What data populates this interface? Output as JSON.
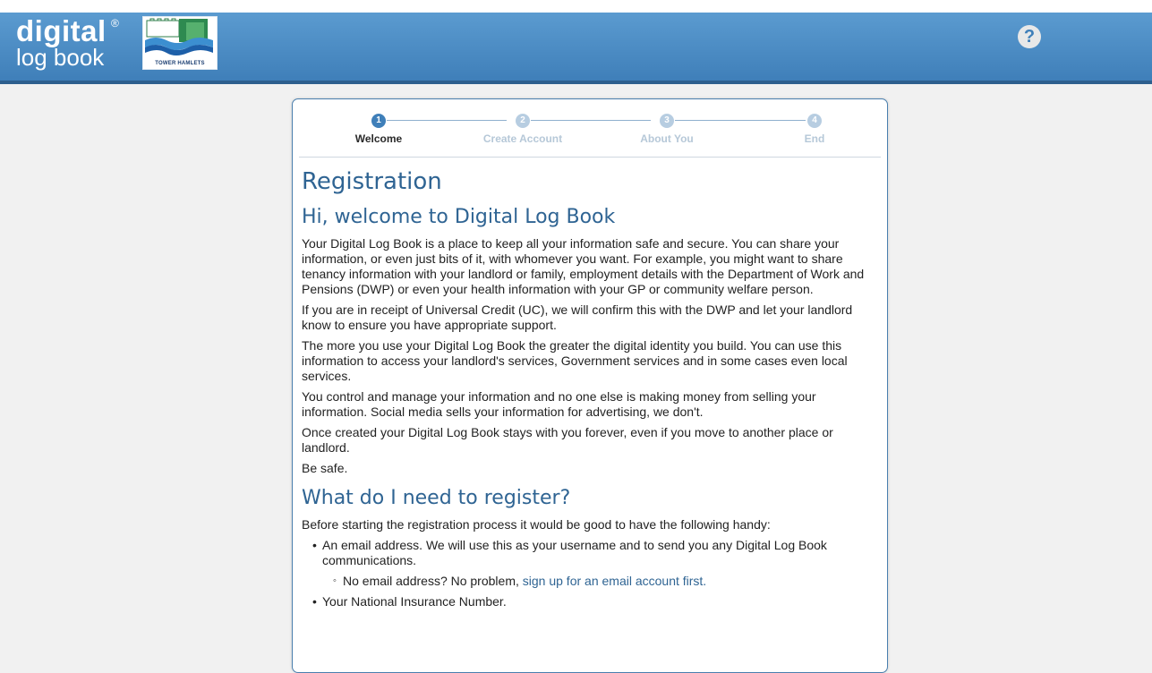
{
  "header": {
    "brand_line1": "digital",
    "brand_reg": "®",
    "brand_line2": "log book",
    "council_caption": "TOWER HAMLETS",
    "help_icon": "question-circle-icon",
    "colors": {
      "header_blue": "#4a8cc7",
      "accent": "#2f6493"
    }
  },
  "stepper": {
    "steps": [
      {
        "number": "1",
        "label": "Welcome"
      },
      {
        "number": "2",
        "label": "Create Account"
      },
      {
        "number": "3",
        "label": "About You"
      },
      {
        "number": "4",
        "label": "End"
      }
    ]
  },
  "content": {
    "title": "Registration",
    "welcome_heading": "Hi, welcome to Digital Log Book",
    "paragraphs": [
      "Your Digital Log Book is a place to keep all your information safe and secure. You can share your information, or even just bits of it, with whomever you want. For example, you might want to share tenancy information with your landlord or family, employment details with the Department of Work and Pensions (DWP) or even your health information with your GP or community welfare person.",
      "If you are in receipt of Universal Credit (UC), we will confirm this with the DWP and let your landlord know to ensure you have appropriate support.",
      "The more you use your Digital Log Book the greater the digital identity you build. You can use this information to access your landlord's services, Government services and in some cases even local services.",
      "You control and manage your information and no one else is making money from selling your information. Social media sells your information for advertising, we don't.",
      "Once created your Digital Log Book stays with you forever, even if you move to another place or landlord.",
      "Be safe."
    ],
    "register_heading": "What do I need to register?",
    "register_intro": "Before starting the registration process it would be good to have the following handy:",
    "list": {
      "email": "An email address. We will use this as your username and to send you any Digital Log Book communications.",
      "no_email_text": "No email address? No problem, ",
      "no_email_link": "sign up for an email account first.",
      "ni_number": "Your National Insurance Number."
    }
  }
}
